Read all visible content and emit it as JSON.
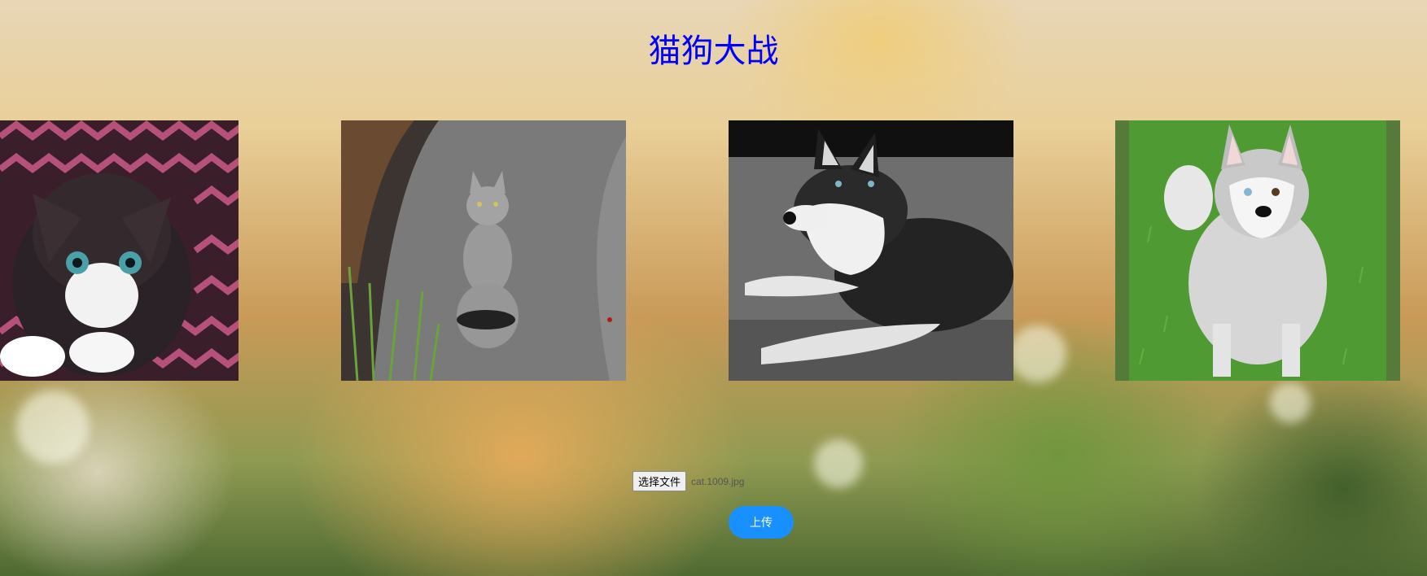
{
  "header": {
    "title": "猫狗大战"
  },
  "gallery": {
    "images": [
      {
        "name": "kitten-photo",
        "subject": "black and white kitten"
      },
      {
        "name": "gray-cat-photo",
        "subject": "gray tabby cat"
      },
      {
        "name": "husky-lying-photo",
        "subject": "husky dog lying"
      },
      {
        "name": "husky-standing-photo",
        "subject": "husky dog standing on grass"
      }
    ]
  },
  "upload": {
    "choose_file_label": "选择文件",
    "selected_file": "cat.1009.jpg",
    "submit_label": "上传",
    "submit_color": "#1890ff"
  },
  "colors": {
    "title": "#0000ff"
  }
}
